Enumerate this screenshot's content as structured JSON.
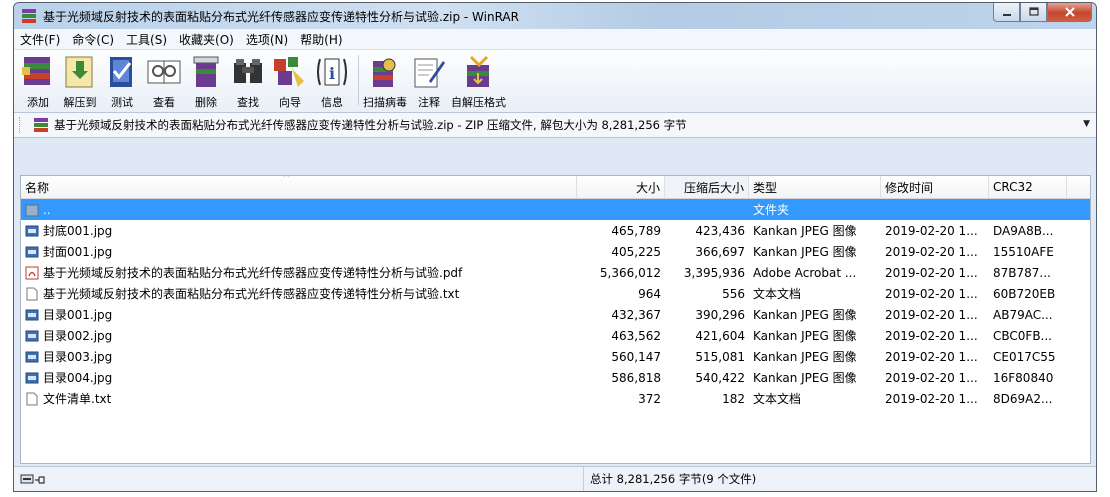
{
  "window": {
    "title": "基于光频域反射技术的表面粘贴分布式光纤传感器应变传递特性分析与试验.zip - WinRAR",
    "buttons": [
      "minimize",
      "maximize",
      "close"
    ]
  },
  "menu": [
    "文件(F)",
    "命令(C)",
    "工具(S)",
    "收藏夹(O)",
    "选项(N)",
    "帮助(H)"
  ],
  "toolbar": [
    {
      "label": "添加",
      "icon": "add-icon"
    },
    {
      "label": "解压到",
      "icon": "extract-to-icon"
    },
    {
      "label": "测试",
      "icon": "test-icon"
    },
    {
      "label": "查看",
      "icon": "view-icon"
    },
    {
      "label": "删除",
      "icon": "delete-icon"
    },
    {
      "label": "查找",
      "icon": "find-icon"
    },
    {
      "label": "向导",
      "icon": "wizard-icon"
    },
    {
      "label": "信息",
      "icon": "info-icon"
    },
    {
      "label": "扫描病毒",
      "icon": "virus-scan-icon"
    },
    {
      "label": "注释",
      "icon": "comment-icon"
    },
    {
      "label": "自解压格式",
      "icon": "sfx-icon"
    }
  ],
  "address": "基于光频域反射技术的表面粘贴分布式光纤传感器应变传递特性分析与试验.zip - ZIP 压缩文件, 解包大小为 8,281,256 字节",
  "columns": [
    "名称",
    "大小",
    "压缩后大小",
    "类型",
    "修改时间",
    "CRC32"
  ],
  "rows": [
    {
      "name": "..",
      "size": "",
      "packed": "",
      "type": "文件夹",
      "modified": "",
      "crc": "",
      "icon": "folder-up",
      "selected": true
    },
    {
      "name": "封底001.jpg",
      "size": "465,789",
      "packed": "423,436",
      "type": "Kankan JPEG 图像",
      "modified": "2019-02-20 1...",
      "crc": "DA9A8B...",
      "icon": "jpg"
    },
    {
      "name": "封面001.jpg",
      "size": "405,225",
      "packed": "366,697",
      "type": "Kankan JPEG 图像",
      "modified": "2019-02-20 1...",
      "crc": "15510AFE",
      "icon": "jpg"
    },
    {
      "name": "基于光频域反射技术的表面粘贴分布式光纤传感器应变传递特性分析与试验.pdf",
      "size": "5,366,012",
      "packed": "3,395,936",
      "type": "Adobe Acrobat ...",
      "modified": "2019-02-20 1...",
      "crc": "87B787...",
      "icon": "pdf"
    },
    {
      "name": "基于光频域反射技术的表面粘贴分布式光纤传感器应变传递特性分析与试验.txt",
      "size": "964",
      "packed": "556",
      "type": "文本文档",
      "modified": "2019-02-20 1...",
      "crc": "60B720EB",
      "icon": "txt"
    },
    {
      "name": "目录001.jpg",
      "size": "432,367",
      "packed": "390,296",
      "type": "Kankan JPEG 图像",
      "modified": "2019-02-20 1...",
      "crc": "AB79AC...",
      "icon": "jpg"
    },
    {
      "name": "目录002.jpg",
      "size": "463,562",
      "packed": "421,604",
      "type": "Kankan JPEG 图像",
      "modified": "2019-02-20 1...",
      "crc": "CBC0FB...",
      "icon": "jpg"
    },
    {
      "name": "目录003.jpg",
      "size": "560,147",
      "packed": "515,081",
      "type": "Kankan JPEG 图像",
      "modified": "2019-02-20 1...",
      "crc": "CE017C55",
      "icon": "jpg"
    },
    {
      "name": "目录004.jpg",
      "size": "586,818",
      "packed": "540,422",
      "type": "Kankan JPEG 图像",
      "modified": "2019-02-20 1...",
      "crc": "16F80840",
      "icon": "jpg"
    },
    {
      "name": "文件清单.txt",
      "size": "372",
      "packed": "182",
      "type": "文本文档",
      "modified": "2019-02-20 1...",
      "crc": "8D69A2...",
      "icon": "txt"
    }
  ],
  "status": {
    "left_icon": "drive-icon",
    "right": "总计 8,281,256 字节(9 个文件)"
  },
  "colors": {
    "selection": "#3399ff",
    "title_bar": "#c4d7ec",
    "close_button": "#c5452f"
  }
}
